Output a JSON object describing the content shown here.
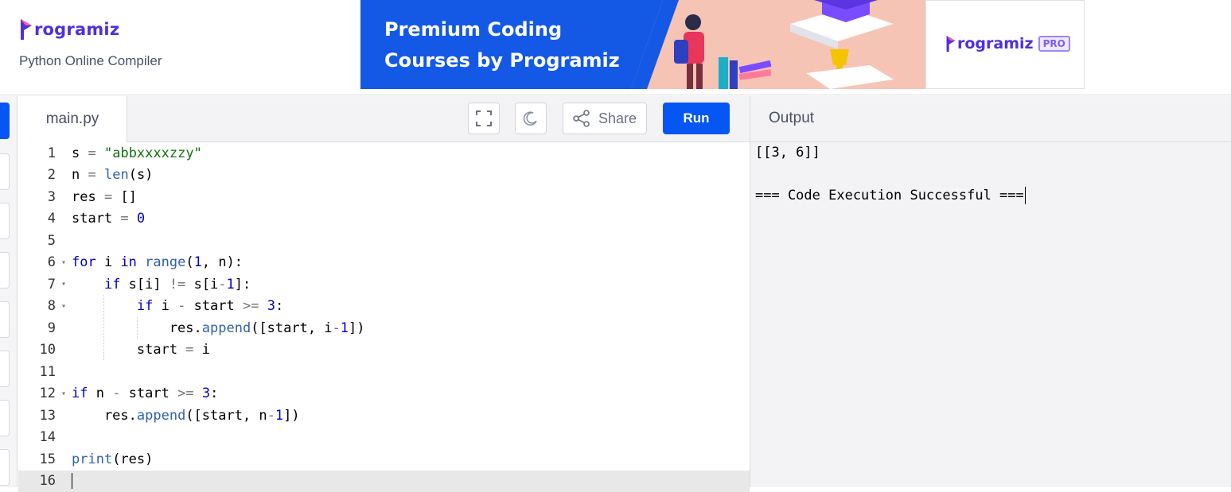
{
  "brand": {
    "name": "rogramiz",
    "subtitle": "Python Online Compiler"
  },
  "banner": {
    "line1": "Premium Coding",
    "line2": "Courses by Programiz",
    "pro_name": "rogramiz",
    "pro_badge": "PRO"
  },
  "editor": {
    "tab_label": "main.py",
    "share_label": "Share",
    "run_label": "Run",
    "lines": [
      "s = \"abbxxxxzzy\"",
      "n = len(s)",
      "res = []",
      "start = 0",
      "",
      "for i in range(1, n):",
      "    if s[i] != s[i-1]:",
      "        if i - start >= 3:",
      "            res.append([start, i-1])",
      "        start = i",
      "",
      "if n - start >= 3:",
      "    res.append([start, n-1])",
      "",
      "print(res)",
      ""
    ],
    "line_numbers": [
      "1",
      "2",
      "3",
      "4",
      "5",
      "6",
      "7",
      "8",
      "9",
      "10",
      "11",
      "12",
      "13",
      "14",
      "15",
      "16"
    ]
  },
  "output": {
    "title": "Output",
    "lines": [
      "[[3, 6]]",
      "",
      "=== Code Execution Successful ==="
    ]
  }
}
